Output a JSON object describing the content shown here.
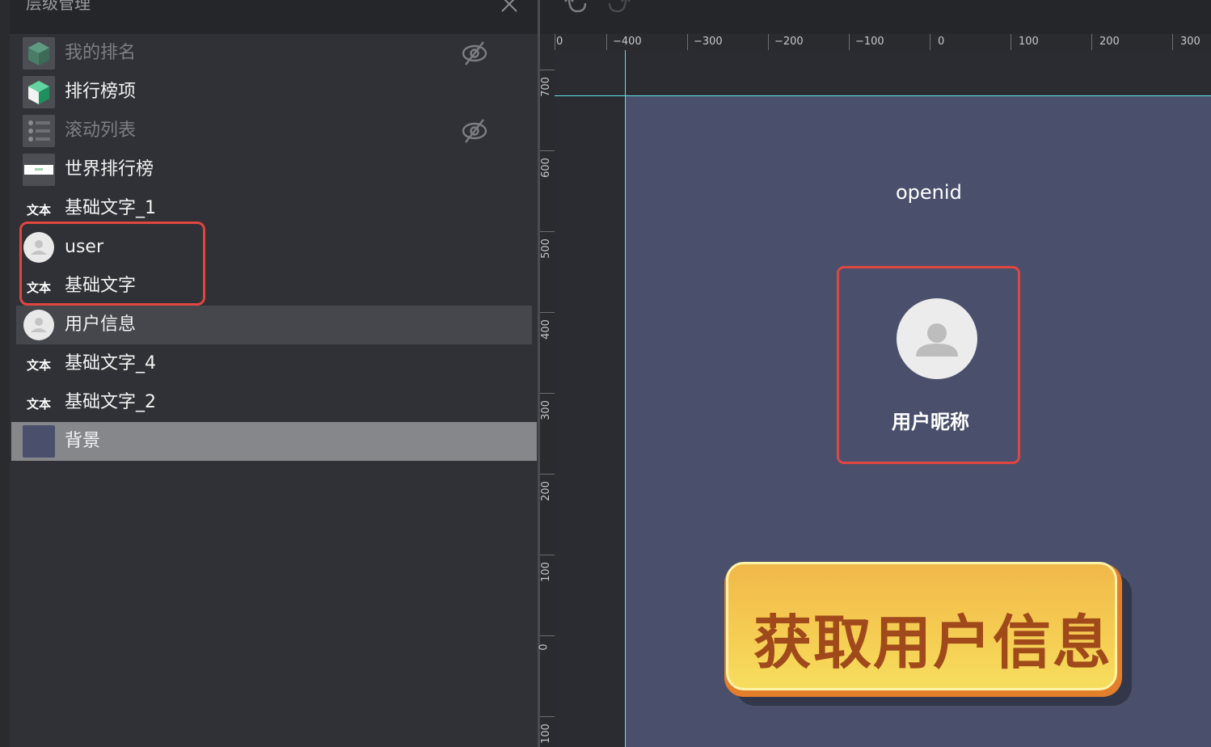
{
  "panel": {
    "title": "层级管理",
    "close_icon": "close-icon"
  },
  "layers": [
    {
      "label": "我的排名",
      "icon": "node-cube-icon",
      "hidden": true
    },
    {
      "label": "排行榜项",
      "icon": "node-cube-icon",
      "hidden": false
    },
    {
      "label": "滚动列表",
      "icon": "scroll-list-icon",
      "hidden": true
    },
    {
      "label": "世界排行榜",
      "icon": "image-thumb-icon",
      "hidden": false
    },
    {
      "label": "基础文字_1",
      "icon": "text-icon",
      "hidden": false
    },
    {
      "label": "user",
      "icon": "avatar-icon",
      "hidden": false
    },
    {
      "label": "基础文字",
      "icon": "text-icon",
      "hidden": false
    },
    {
      "label": "用户信息",
      "icon": "avatar-icon",
      "hidden": false,
      "selected": true
    },
    {
      "label": "基础文字_4",
      "icon": "text-icon",
      "hidden": false
    },
    {
      "label": "基础文字_2",
      "icon": "text-icon",
      "hidden": false
    },
    {
      "label": "背景",
      "icon": "color-swatch-icon",
      "hidden": false,
      "selected": true
    }
  ],
  "text_icon_label": "文本",
  "ruler": {
    "top_ticks": [
      "0",
      "−400",
      "−300",
      "−200",
      "−100",
      "0",
      "100",
      "200",
      "300"
    ],
    "left_ticks": [
      "700",
      "600",
      "500",
      "400",
      "300",
      "200",
      "100",
      "0",
      "100"
    ]
  },
  "stage": {
    "openid": "openid",
    "nickname": "用户昵称",
    "button_label": "获取用户信息"
  },
  "colors": {
    "stage_bg": "#4a506c",
    "guide": "#5fe0e6",
    "annotation": "#e0463f",
    "button_text": "#a04a1b",
    "button_fill": "#f5cc52"
  }
}
